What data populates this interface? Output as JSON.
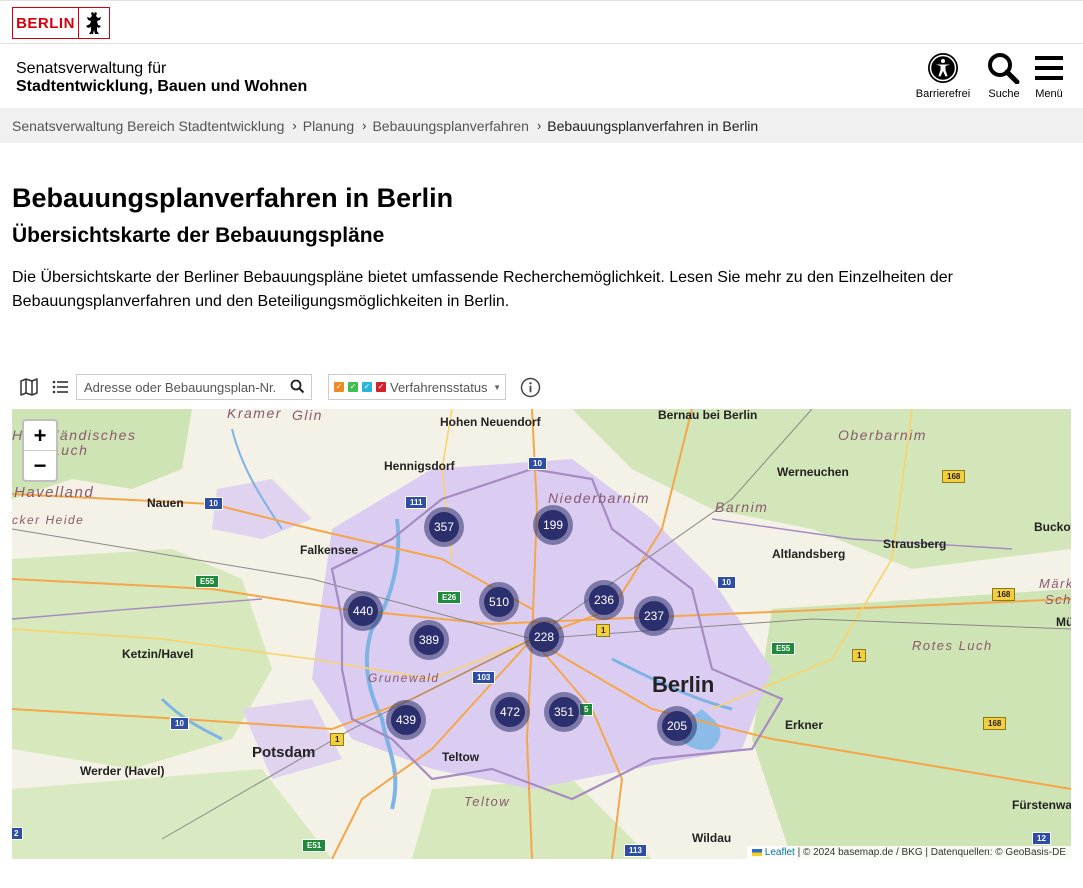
{
  "header": {
    "logo_text": "BERLIN",
    "dept_line1": "Senatsverwaltung für",
    "dept_line2": "Stadtentwicklung, Bauen und Wohnen",
    "accessibility_label": "Barrierefrei",
    "search_label": "Suche",
    "menu_label": "Menü"
  },
  "breadcrumb": [
    "Senatsverwaltung Bereich Stadtentwicklung",
    "Planung",
    "Bebauungsplanverfahren",
    "Bebauungsplanverfahren in Berlin"
  ],
  "page": {
    "title": "Bebauungsplanverfahren in Berlin",
    "subtitle": "Übersichtskarte der Bebauungspläne",
    "intro": "Die Übersichtskarte der Berliner Bebauungspläne bietet umfassende Recherchemöglichkeit. Lesen Sie mehr zu den Einzelheiten der Bebauungsplanverfahren und den Beteiligungsmöglichkeiten in Berlin."
  },
  "map_toolbar": {
    "search_placeholder": "Adresse oder Bebauungsplan-Nr.",
    "status_label": "Verfahrensstatus",
    "status_colors": [
      "#f08a24",
      "#3fbf4f",
      "#2bb5d6",
      "#d4202a"
    ]
  },
  "map": {
    "zoom_in": "+",
    "zoom_out": "−",
    "clusters": [
      "357",
      "199",
      "510",
      "236",
      "237",
      "440",
      "389",
      "228",
      "472",
      "351",
      "439",
      "205"
    ],
    "places": [
      "Hohen Neuendorf",
      "Bernau bei Berlin",
      "Hennigsdorf",
      "Werneuchen",
      "Nauen",
      "Falkensee",
      "Altlandsberg",
      "Strausberg",
      "Ketzin/Havel",
      "Berlin",
      "Erkner",
      "Potsdam",
      "Teltow",
      "Werder (Havel)",
      "Wildau",
      "Fürstenwa",
      "Buckow",
      "Mü"
    ],
    "regions": [
      "Kramer",
      "Glin",
      "Oberbarnim",
      "Havelländisches",
      "Luch",
      "Niederbarnim",
      "Barnim",
      "Havelland",
      "cker Heide",
      "Grunewald",
      "Rotes Luch",
      "Teltow",
      "Märk",
      "Sch"
    ],
    "road_shields": [
      "10",
      "111",
      "10",
      "168",
      "E55",
      "E26",
      "10",
      "1",
      "168",
      "103",
      "E55",
      "1",
      "10",
      "5",
      "1",
      "168",
      "E51",
      "113",
      "12",
      "2"
    ],
    "attribution_leaflet": "Leaflet",
    "attribution_text": "| © 2024 basemap.de / BKG | Datenquellen: © GeoBasis-DE"
  }
}
